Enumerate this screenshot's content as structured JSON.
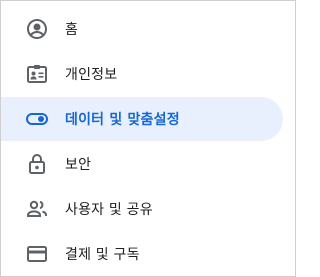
{
  "nav": {
    "items": [
      {
        "label": "홈",
        "icon": "account-circle-icon",
        "active": false
      },
      {
        "label": "개인정보",
        "icon": "id-card-icon",
        "active": false
      },
      {
        "label": "데이터 및 맞춤설정",
        "icon": "toggle-icon",
        "active": true
      },
      {
        "label": "보안",
        "icon": "lock-icon",
        "active": false
      },
      {
        "label": "사용자 및 공유",
        "icon": "people-icon",
        "active": false
      },
      {
        "label": "결제 및 구독",
        "icon": "credit-card-icon",
        "active": false
      }
    ]
  },
  "colors": {
    "active_background": "#e8f0fe",
    "active_text": "#1967d2",
    "text": "#202124",
    "icon": "#5f6368"
  }
}
